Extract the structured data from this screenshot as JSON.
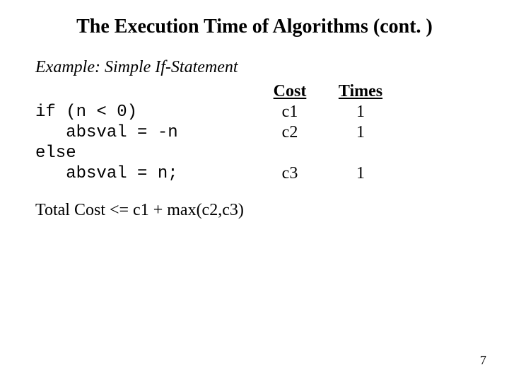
{
  "title": "The Execution Time of Algorithms (cont. )",
  "example_heading": "Example: Simple If-Statement",
  "headers": {
    "cost": "Cost",
    "times": "Times"
  },
  "rows": [
    {
      "code": "if (n < 0)",
      "cost": "c1",
      "times": "1"
    },
    {
      "code": "   absval = -n",
      "cost": "c2",
      "times": "1"
    },
    {
      "code": "else",
      "cost": "",
      "times": ""
    },
    {
      "code": "   absval = n;",
      "cost": "c3",
      "times": "1"
    }
  ],
  "total_cost": "Total Cost  <=  c1 + max(c2,c3)",
  "page_number": "7"
}
